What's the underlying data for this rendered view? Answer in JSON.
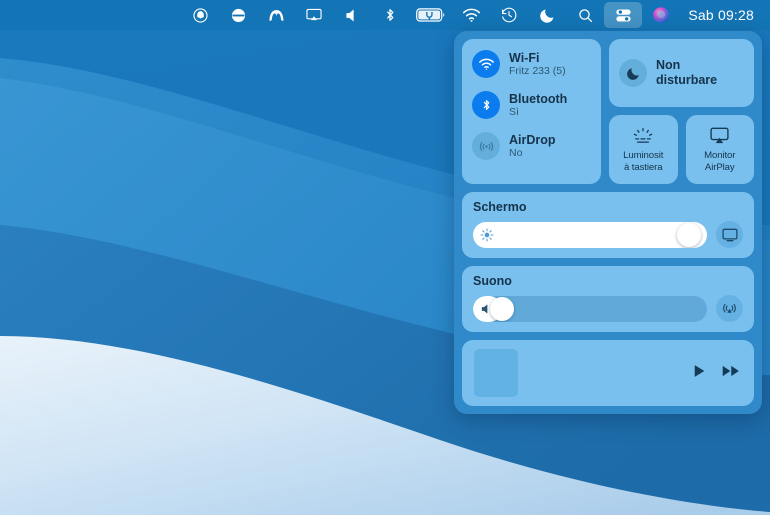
{
  "menubar": {
    "items": [
      {
        "name": "app-status-icon-circle-face",
        "icon": "circle-face-icon"
      },
      {
        "name": "app-status-icon-disc",
        "icon": "disc-bar-icon"
      },
      {
        "name": "app-status-icon-malwarebytes",
        "icon": "letter-m-icon"
      },
      {
        "name": "airplay-display-status",
        "icon": "airplay-display-icon"
      },
      {
        "name": "volume-status",
        "icon": "speaker-icon"
      },
      {
        "name": "bluetooth-status",
        "icon": "bluetooth-icon"
      },
      {
        "name": "battery-status",
        "icon": "battery-charging-icon"
      },
      {
        "name": "wifi-status",
        "icon": "wifi-icon"
      },
      {
        "name": "time-machine-status",
        "icon": "clock-rewind-icon"
      },
      {
        "name": "do-not-disturb-status",
        "icon": "moon-icon"
      },
      {
        "name": "spotlight-search",
        "icon": "search-icon"
      },
      {
        "name": "control-center",
        "icon": "control-center-icon"
      },
      {
        "name": "siri",
        "icon": "siri-icon"
      }
    ],
    "clock": "Sab 09:28"
  },
  "control_center": {
    "connectivity": [
      {
        "title": "Wi-Fi",
        "value": "Fritz 233 (5)",
        "state": "on",
        "icon": "wifi-icon"
      },
      {
        "title": "Bluetooth",
        "value": "Sì",
        "state": "on",
        "icon": "bluetooth-icon"
      },
      {
        "title": "AirDrop",
        "value": "No",
        "state": "off",
        "icon": "airdrop-icon"
      }
    ],
    "do_not_disturb": {
      "label": "Non disturbare",
      "icon": "moon-icon"
    },
    "tiles": [
      {
        "label": "Luminosità tastiera",
        "label_line1": "Luminosit",
        "label_line2": "à tastiera",
        "icon": "keyboard-brightness-icon"
      },
      {
        "label": "Monitor AirPlay",
        "label_line1": "Monitor",
        "label_line2": "AirPlay",
        "icon": "airplay-display-icon"
      }
    ],
    "display": {
      "title": "Schermo",
      "value": 97,
      "glyph": "brightness-sun-icon",
      "button_icon": "display-icon"
    },
    "sound": {
      "title": "Suono",
      "value": 8,
      "glyph": "speaker-icon",
      "button_icon": "airplay-audio-icon"
    },
    "media": {
      "album_art": "empty-album-art",
      "play_label": "play-button",
      "next_label": "fast-forward-button"
    }
  },
  "colors": {
    "panel_bg": "#3089c9",
    "card_bg": "#79c0ee",
    "accent_blue": "#0a7ced",
    "text_dark": "#15334a",
    "menubar_bg": "#1274b4"
  }
}
